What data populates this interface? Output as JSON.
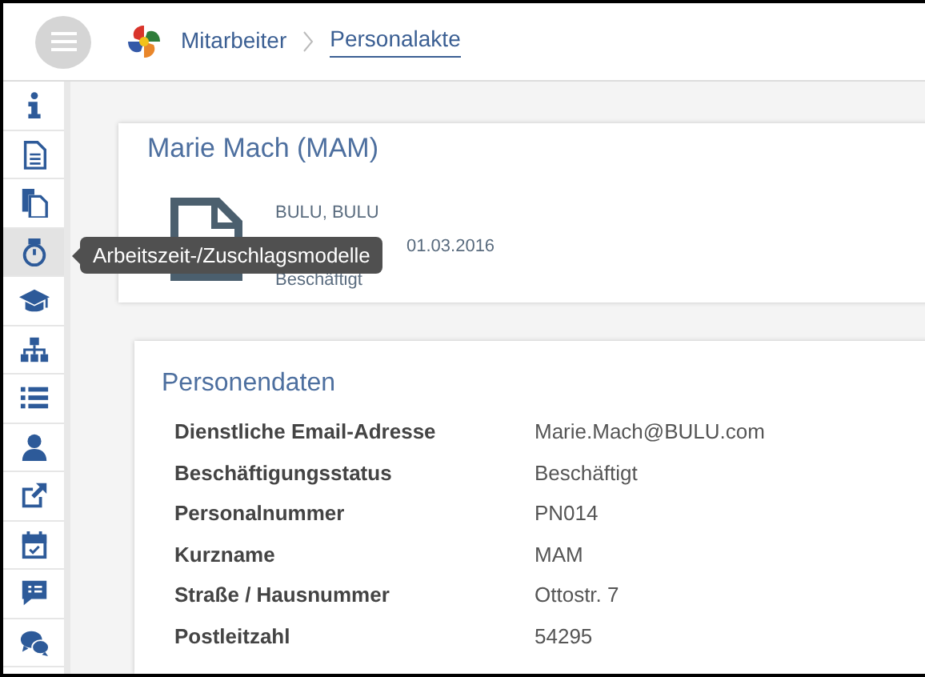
{
  "breadcrumb": [
    {
      "label": "Mitarbeiter",
      "current": false
    },
    {
      "label": "Personalakte",
      "current": true
    }
  ],
  "sidebar": {
    "items": [
      {
        "kind": "info",
        "selected": false
      },
      {
        "kind": "document",
        "selected": false
      },
      {
        "kind": "copies",
        "selected": false
      },
      {
        "kind": "stopwatch",
        "selected": true
      },
      {
        "kind": "graduation",
        "selected": false
      },
      {
        "kind": "hierarchy",
        "selected": false
      },
      {
        "kind": "list",
        "selected": false
      },
      {
        "kind": "person",
        "selected": false
      },
      {
        "kind": "external",
        "selected": false
      },
      {
        "kind": "calendar",
        "selected": false
      },
      {
        "kind": "comment",
        "selected": false
      },
      {
        "kind": "chat",
        "selected": false
      }
    ]
  },
  "tooltip": "Arbeitszeit-/Zuschlagsmodelle",
  "person": {
    "title": "Marie Mach (MAM)",
    "lines": [
      "BULU, BULU",
      "01.03.2016",
      "Beschäftigt"
    ]
  },
  "personendaten": {
    "title": "Personendaten",
    "rows": [
      {
        "label": "Dienstliche Email-Adresse",
        "value": "Marie.Mach@BULU.com"
      },
      {
        "label": "Beschäftigungsstatus",
        "value": "Beschäftigt"
      },
      {
        "label": "Personalnummer",
        "value": "PN014"
      },
      {
        "label": "Kurzname",
        "value": "MAM"
      },
      {
        "label": "Straße / Hausnummer",
        "value": "Ottostr. 7"
      },
      {
        "label": "Postleitzahl",
        "value": "54295"
      }
    ]
  }
}
